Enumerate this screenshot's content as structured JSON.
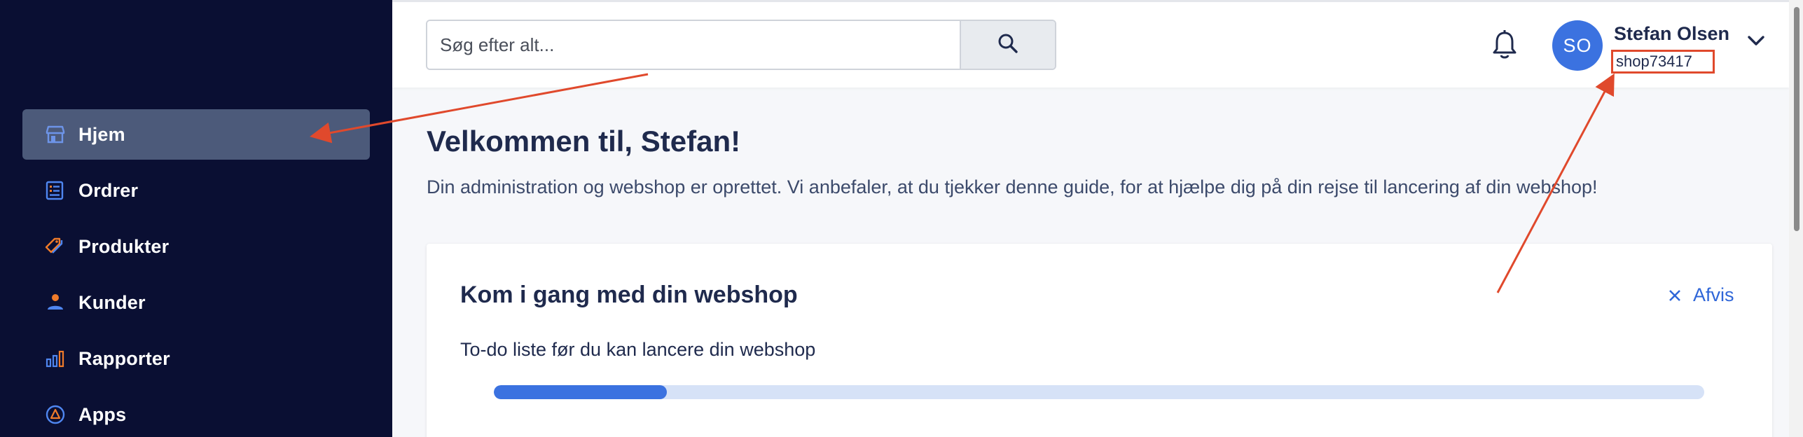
{
  "sidebar": {
    "items": [
      {
        "label": "Hjem",
        "icon": "store-icon",
        "active": true
      },
      {
        "label": "Ordrer",
        "icon": "orders-icon"
      },
      {
        "label": "Produkter",
        "icon": "tag-icon"
      },
      {
        "label": "Kunder",
        "icon": "person-icon"
      },
      {
        "label": "Rapporter",
        "icon": "bar-chart-icon"
      },
      {
        "label": "Apps",
        "icon": "apps-icon"
      }
    ]
  },
  "header": {
    "search_placeholder": "Søg efter alt...",
    "avatar_initials": "SO",
    "user_name": "Stefan Olsen",
    "shop_id": "shop73417"
  },
  "main": {
    "title": "Velkommen til, Stefan!",
    "subtitle": "Din administration og webshop er oprettet. Vi anbefaler, at du tjekker denne guide, for at hjælpe dig på din rejse til lancering af din webshop!",
    "card": {
      "title": "Kom i gang med din webshop",
      "dismiss_label": "Afvis",
      "subtitle": "To-do liste før du kan lancere din webshop",
      "progress": 0.143
    }
  },
  "colors": {
    "sidebar_bg": "#0a0f33",
    "accent": "#3b72e0",
    "annotation": "#e0492c"
  }
}
